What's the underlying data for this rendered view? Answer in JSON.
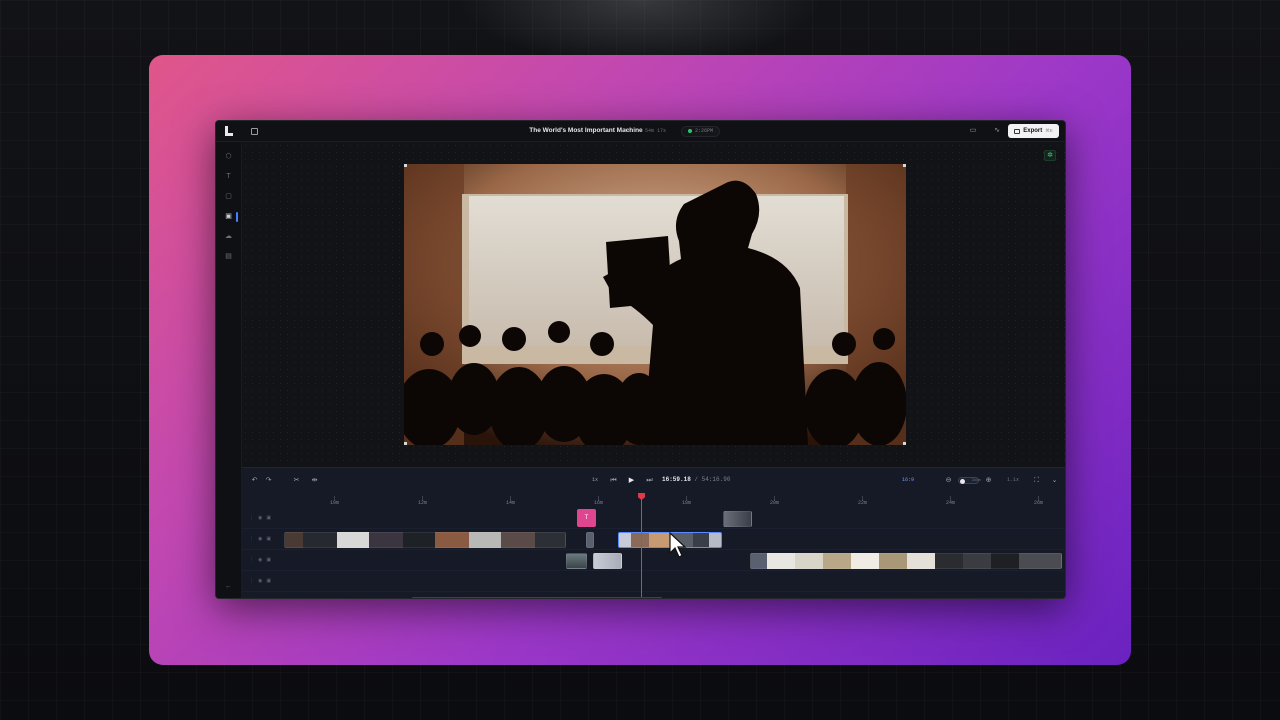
{
  "app": {
    "title": "The World's Most Important Machine",
    "meta": "16:9 · 54m 17s",
    "pill_label": "2:26PM",
    "export_label": "Export",
    "export_shortcut": "⌘E"
  },
  "timeline": {
    "speed": "1x",
    "timecode_current": "16:59.18",
    "timecode_total": "/ 54:16.90",
    "ratio": "16:9",
    "zoom_label": "Zoom",
    "zoom_value": "1.1x",
    "ruler": [
      "10m",
      "12m",
      "14m",
      "16m",
      "18m",
      "20m",
      "22m",
      "24m",
      "26m"
    ]
  },
  "colors": {
    "accent_blue": "#4a7dff",
    "playhead": "#e03a4a",
    "title_clip": "#e0468f",
    "status_green": "#28c86a"
  },
  "icons": {
    "left_rail": [
      "cube-icon",
      "text-icon",
      "media-icon",
      "cloud-icon",
      "layout-icon",
      "collapse-icon"
    ],
    "toolbar": [
      "undo-icon",
      "redo-icon",
      "scissors-icon",
      "split-icon",
      "skip-back-icon",
      "play-icon",
      "skip-forward-icon",
      "zoom-out-icon",
      "zoom-in-icon",
      "fullscreen-icon",
      "chevron-down-icon"
    ]
  }
}
